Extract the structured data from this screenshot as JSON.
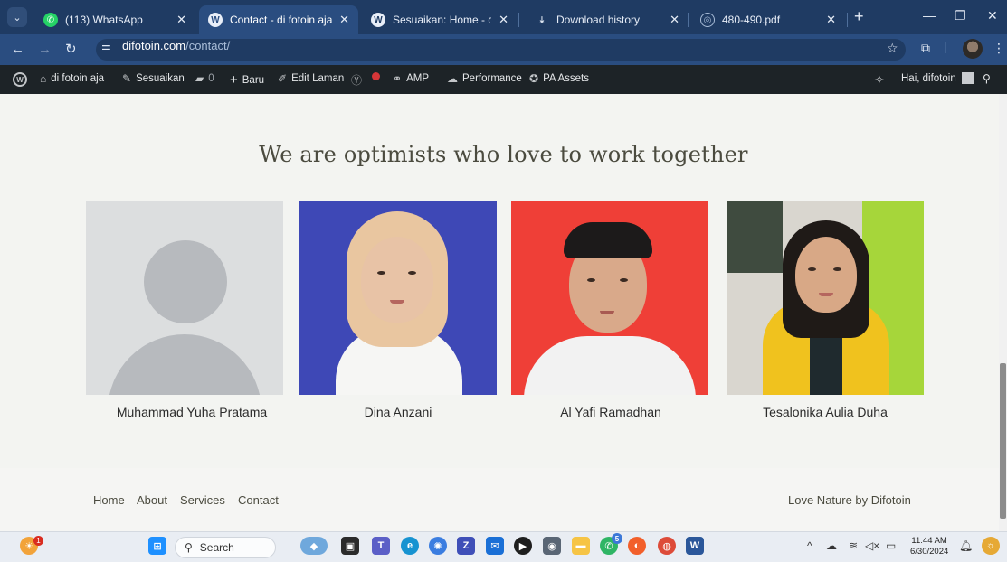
{
  "browser": {
    "tabs": [
      {
        "title": "(113) WhatsApp",
        "icon": "whatsapp-icon",
        "active": false
      },
      {
        "title": "Contact - di fotoin aja",
        "icon": "wordpress-icon",
        "active": true
      },
      {
        "title": "Sesuaikan: Home - di fotoin",
        "icon": "wordpress-icon",
        "active": false
      },
      {
        "title": "Download history",
        "icon": "download-icon",
        "active": false
      },
      {
        "title": "480-490.pdf",
        "icon": "globe-icon",
        "active": false
      }
    ],
    "url_host": "difotoin.com",
    "url_path": "/contact/"
  },
  "admin_bar": {
    "site_name": "di fotoin aja",
    "customize": "Sesuaikan",
    "comments_count": "0",
    "new": "Baru",
    "edit_page": "Edit Laman",
    "amp": "AMP",
    "performance": "Performance",
    "pa_assets": "PA Assets",
    "greeting": "Hai, difotoin"
  },
  "page": {
    "headline": "We are optimists who love to work together",
    "members": [
      {
        "name": "Muhammad Yuha Pratama",
        "photo": "placeholder"
      },
      {
        "name": "Dina Anzani",
        "photo": "blue-background"
      },
      {
        "name": "Al Yafi Ramadhan",
        "photo": "red-background"
      },
      {
        "name": "Tesalonika Aulia Duha",
        "photo": "yellow-jacket"
      }
    ]
  },
  "footer": {
    "links": [
      "Home",
      "About",
      "Services",
      "Contact"
    ],
    "credit": "Love Nature by Difotoin"
  },
  "taskbar": {
    "search_label": "Search",
    "notification_badge": "1",
    "chrome_badge": "5",
    "time": "11:44 AM",
    "date": "6/30/2024"
  },
  "colors": {
    "tab_bar": "#1f3b63",
    "address_bar": "#2a4d80",
    "admin_bar": "#1d2327",
    "page_bg": "#f3f4f1",
    "headline": "#4b4b3f"
  }
}
